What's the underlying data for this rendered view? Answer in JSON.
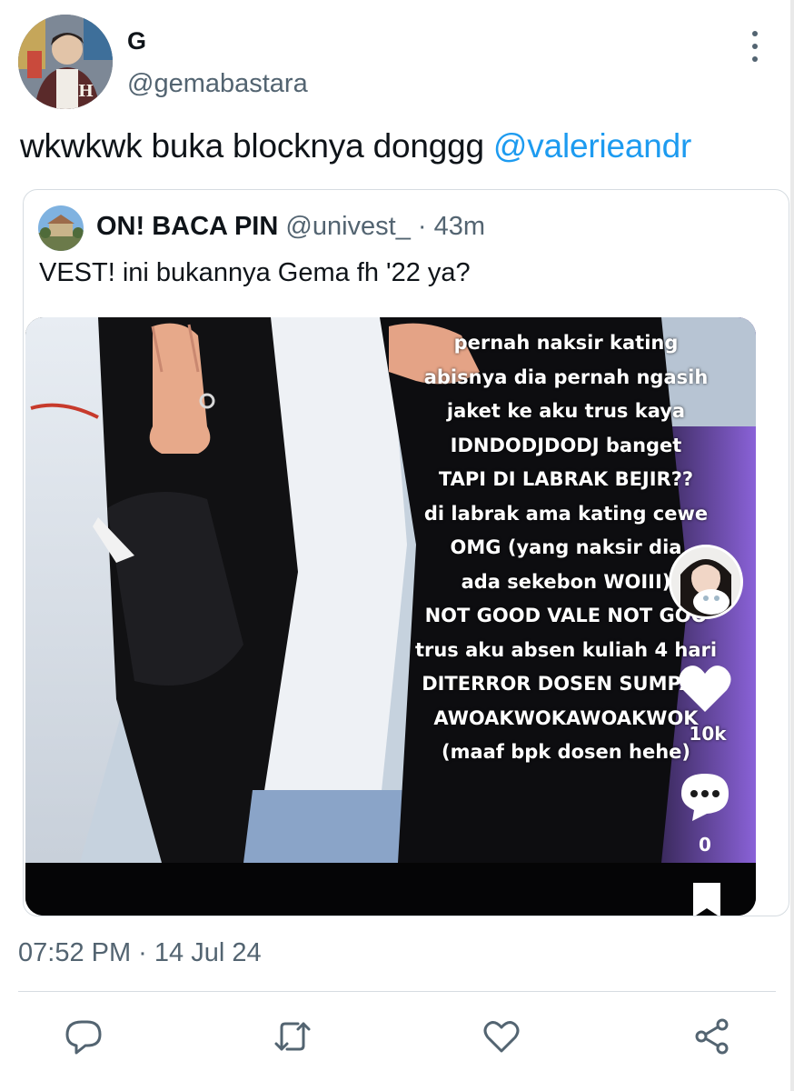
{
  "author": {
    "display_name": "G",
    "handle": "@gemabastara",
    "avatar_icon": "avatar-photo"
  },
  "more_icon": "more-vertical-icon",
  "tweet": {
    "text": "wkwkwk buka blocknya donggg ",
    "mention": "@valerieandr",
    "timestamp": "07:52 PM · 14 Jul 24"
  },
  "quoted": {
    "name": "ON! BACA PIN",
    "handle": "@univest_",
    "separator": "·",
    "time": "43m",
    "text": "VEST! ini bukannya Gema fh '22 ya?",
    "media": {
      "overlay_lines": [
        "pernah naksir kating",
        "abisnya dia pernah ngasih",
        "jaket ke aku trus kaya",
        "IDNDODJDODJ banget",
        "TAPI DI LABRAK BEJIR??",
        "di labrak ama kating cewe",
        "OMG (yang naksir dia",
        "ada sekebon WOIII)",
        "NOT GOOD VALE NOT GOO",
        "trus aku absen kuliah 4 hari",
        "DITERROR DOSEN SUMPAH",
        "AWOAKWOKAWOAKWOK",
        "(maaf bpk dosen hehe)"
      ],
      "like_count": "10k",
      "comment_count": "0"
    }
  },
  "actions": [
    {
      "name": "reply-icon"
    },
    {
      "name": "retweet-icon"
    },
    {
      "name": "like-icon"
    },
    {
      "name": "share-icon"
    }
  ],
  "colors": {
    "link": "#1d9bf0",
    "secondary_text": "#536471",
    "border": "#d6dce1",
    "primary_text": "#0f1419"
  }
}
